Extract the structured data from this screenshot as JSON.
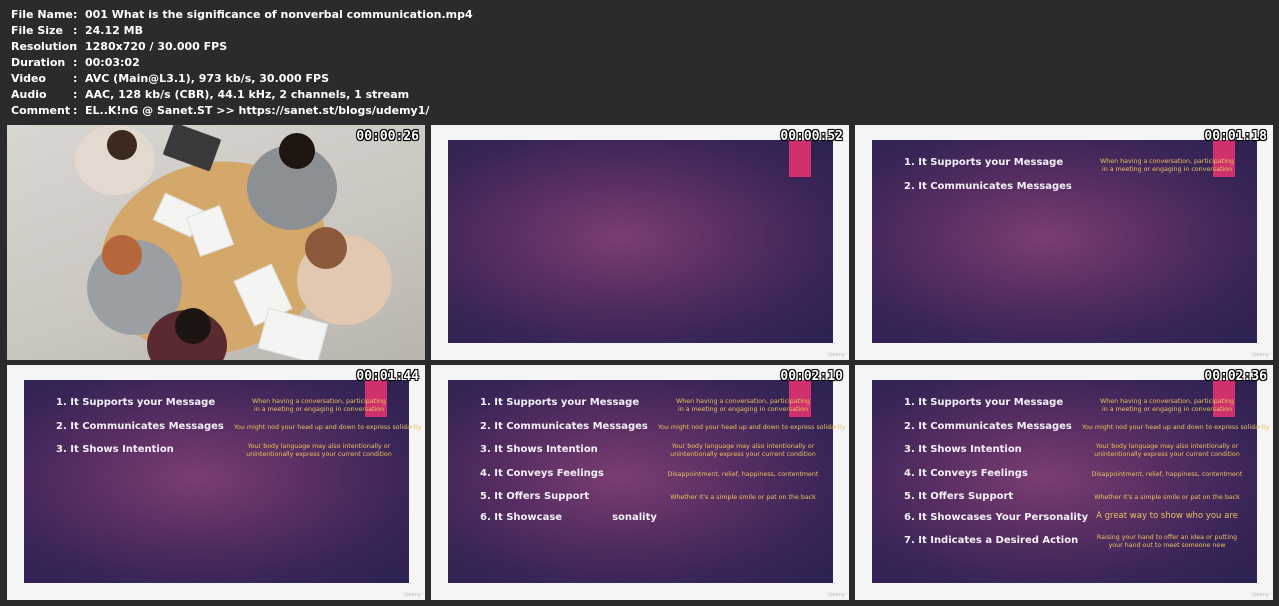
{
  "meta": [
    {
      "key": "File Name",
      "value": "001 What is the significance of nonverbal communication.mp4"
    },
    {
      "key": "File Size",
      "value": "24.12 MB"
    },
    {
      "key": "Resolution",
      "value": "1280x720 / 30.000 FPS"
    },
    {
      "key": "Duration",
      "value": "00:03:02"
    },
    {
      "key": "Video",
      "value": "AVC (Main@L3.1), 973 kb/s, 30.000 FPS"
    },
    {
      "key": "Audio",
      "value": "AAC, 128 kb/s (CBR), 44.1 kHz, 2 channels, 1 stream"
    },
    {
      "key": "Comment",
      "value": "EL..K!nG @ Sanet.ST  >> https://sanet.st/blogs/udemy1/"
    }
  ],
  "separator": ":",
  "thumbnails": [
    {
      "timestamp": "00:00:26"
    },
    {
      "timestamp": "00:00:52"
    },
    {
      "timestamp": "00:01:18"
    },
    {
      "timestamp": "00:01:44"
    },
    {
      "timestamp": "00:02:10"
    },
    {
      "timestamp": "00:02:36"
    }
  ],
  "slide_items": [
    "1. It Supports your Message",
    "2. It Communicates Messages",
    "3. It Shows Intention",
    "4. It Conveys Feelings",
    "5. It Offers Support",
    "6. It Showcases Your Personality",
    "7. It Indicates a Desired Action"
  ],
  "slide_item_6_partial_left": "6. It Showcase",
  "slide_item_6_partial_right": "sonality",
  "slide_notes": [
    [
      "When having a conversation, participating",
      "in a meeting or engaging in conversation"
    ],
    [
      "You might nod your head up and down to express solidarity"
    ],
    [
      "Your body language may also intentionally or",
      "unintentionally express your current condition"
    ],
    [
      "Disappointment, relief, happiness, contentment"
    ],
    [
      "Whether it's a simple smile or pat on the back"
    ],
    [
      "A great way to show who you are"
    ],
    [
      "Raising your hand to offer an idea or putting",
      "your hand out to meet someone new"
    ]
  ],
  "watermark": "Udemy",
  "colors": {
    "background": "#2b2b2b",
    "slide_accent_tab": "#d0316c",
    "note_text": "#e8c25e",
    "slide_dark": "#2b2150",
    "slide_center": "#7b3d72"
  }
}
